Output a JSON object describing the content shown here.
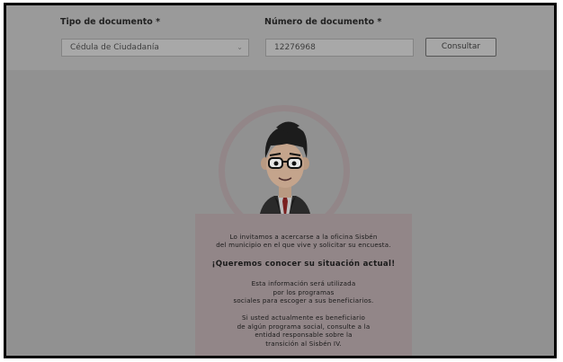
{
  "form": {
    "doc_type_label": "Tipo de documento *",
    "doc_type_value": "Cédula de Ciudadanía",
    "doc_number_label": "Número de documento *",
    "doc_number_value": "12276968",
    "consult_button": "Consultar"
  },
  "icons": {
    "select_chevron": "chevron-down-icon",
    "avatar": "businessman-avatar"
  },
  "message": {
    "line1": "Lo invitamos a acercarse a la oficina Sisbén",
    "line2": "del municipio en el que vive y solicitar su encuesta.",
    "headline": "¡Queremos conocer su situación actual!",
    "info1": "Esta información será utilizada",
    "info2": "por los programas",
    "info3": "sociales para escoger a sus beneficiarios.",
    "note1": "Si usted actualmente es beneficiario",
    "note2": "de algún programa social, consulte a la",
    "note3": "entidad responsable sobre la",
    "note4": "transición al Sisbén IV."
  },
  "colors": {
    "overlay": "#919191",
    "card": "#928688",
    "ring": "#928688"
  }
}
